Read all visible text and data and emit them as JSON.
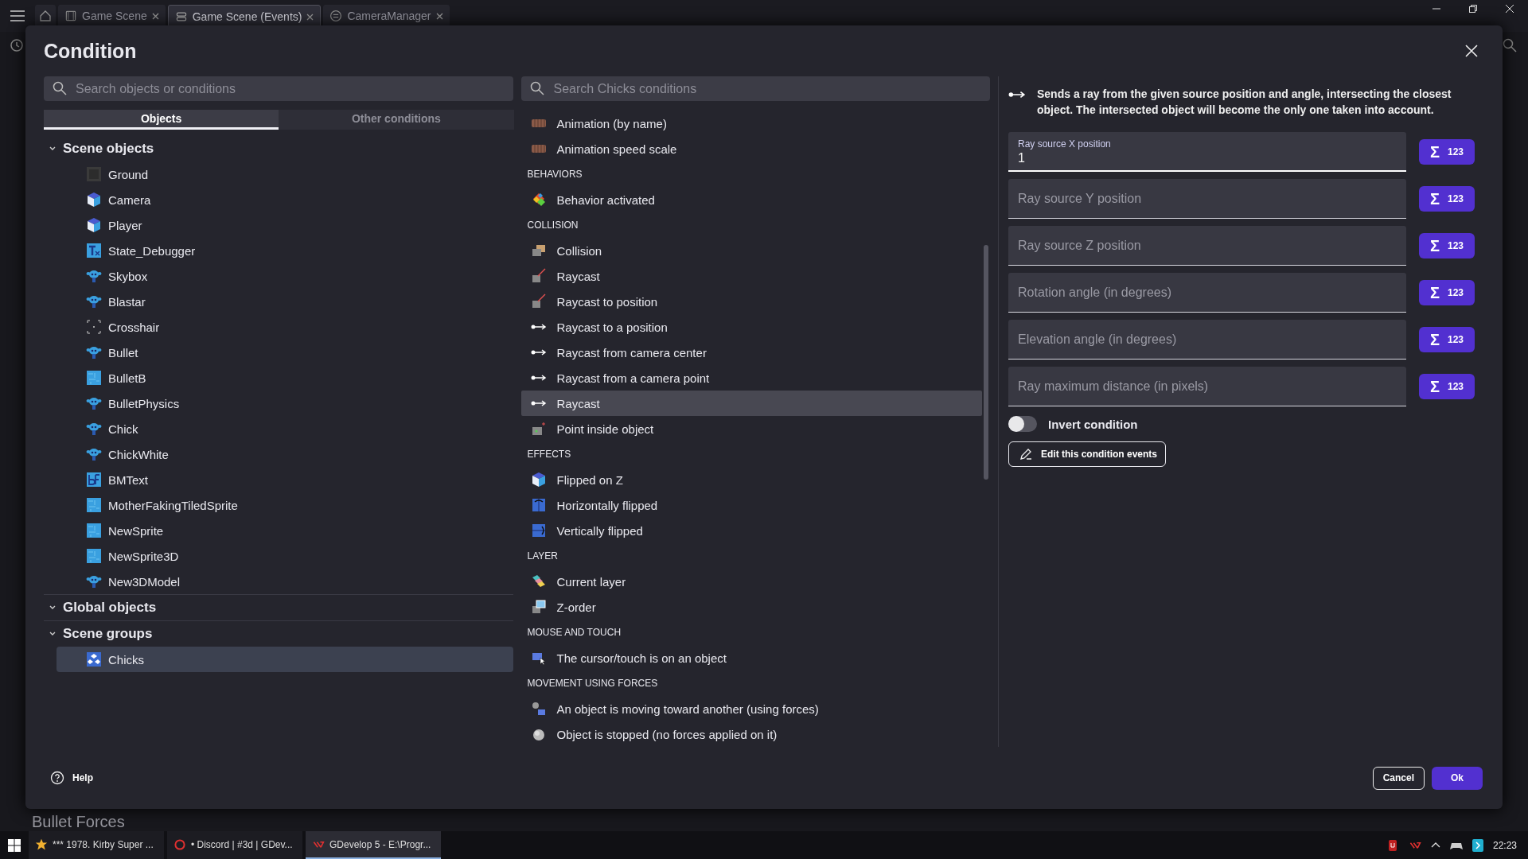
{
  "top_bar": {
    "tabs": [
      {
        "label": "Game Scene",
        "selected": false
      },
      {
        "label": "Game Scene (Events)",
        "selected": true
      },
      {
        "label": "CameraManager",
        "selected": false
      }
    ]
  },
  "background": {
    "heading": "Bullet Forces"
  },
  "dialog": {
    "title": "Condition",
    "object_search": {
      "placeholder": "Search objects or conditions"
    },
    "object_tabs": [
      {
        "label": "Objects",
        "selected": true
      },
      {
        "label": "Other conditions",
        "selected": false
      }
    ],
    "object_tree": [
      {
        "label": "Scene objects",
        "expanded": true,
        "children": [
          {
            "label": "Ground",
            "kind": "tile",
            "selected": false
          },
          {
            "label": "Camera",
            "kind": "cube",
            "selected": false
          },
          {
            "label": "Player",
            "kind": "cube",
            "selected": false
          },
          {
            "label": "State_Debugger",
            "kind": "text",
            "selected": false
          },
          {
            "label": "Skybox",
            "kind": "model",
            "selected": false
          },
          {
            "label": "Blastar",
            "kind": "model",
            "selected": false
          },
          {
            "label": "Crosshair",
            "kind": "crosshair",
            "selected": false
          },
          {
            "label": "Bullet",
            "kind": "model",
            "selected": false
          },
          {
            "label": "BulletB",
            "kind": "sprite",
            "selected": false
          },
          {
            "label": "BulletPhysics",
            "kind": "model",
            "selected": false
          },
          {
            "label": "Chick",
            "kind": "model",
            "selected": false
          },
          {
            "label": "ChickWhite",
            "kind": "model",
            "selected": false
          },
          {
            "label": "BMText",
            "kind": "bitmap",
            "selected": false
          },
          {
            "label": "MotherFakingTiledSprite",
            "kind": "sprite",
            "selected": false
          },
          {
            "label": "NewSprite",
            "kind": "sprite",
            "selected": false
          },
          {
            "label": "NewSprite3D",
            "kind": "sprite",
            "selected": false
          },
          {
            "label": "New3DModel",
            "kind": "model",
            "selected": false
          }
        ]
      },
      {
        "label": "Global objects",
        "expanded": true
      },
      {
        "label": "Scene groups",
        "expanded": true,
        "children": [
          {
            "label": "Chicks",
            "kind": "group",
            "selected": true
          }
        ]
      }
    ],
    "condition_search": {
      "placeholder": "Search Chicks conditions"
    },
    "conditions": [
      {
        "kind": "animation",
        "label": "Animation (by name)",
        "selected": false
      },
      {
        "kind": "animation",
        "label": "Animation speed scale",
        "selected": false
      },
      {
        "kind": "header",
        "label": "BEHAVIORS"
      },
      {
        "kind": "behavior",
        "label": "Behavior activated",
        "selected": false
      },
      {
        "kind": "header",
        "label": "COLLISION"
      },
      {
        "kind": "collision",
        "label": "Collision",
        "selected": false
      },
      {
        "kind": "raybox",
        "label": "Raycast",
        "selected": false
      },
      {
        "kind": "raybox",
        "label": "Raycast to position",
        "selected": false
      },
      {
        "kind": "ray",
        "label": "Raycast to a position",
        "selected": false
      },
      {
        "kind": "ray",
        "label": "Raycast from camera center",
        "selected": false
      },
      {
        "kind": "ray",
        "label": "Raycast from a camera point",
        "selected": false
      },
      {
        "kind": "ray",
        "label": "Raycast",
        "selected": true
      },
      {
        "kind": "point",
        "label": "Point inside object",
        "selected": false
      },
      {
        "kind": "header",
        "label": "EFFECTS"
      },
      {
        "kind": "cube",
        "label": "Flipped on Z",
        "selected": false
      },
      {
        "kind": "hflip",
        "label": "Horizontally flipped",
        "selected": false
      },
      {
        "kind": "vflip",
        "label": "Vertically flipped",
        "selected": false
      },
      {
        "kind": "header",
        "label": "LAYER"
      },
      {
        "kind": "layer",
        "label": "Current layer",
        "selected": false
      },
      {
        "kind": "zorder",
        "label": "Z-order",
        "selected": false
      },
      {
        "kind": "header",
        "label": "MOUSE AND TOUCH"
      },
      {
        "kind": "cursor",
        "label": "The cursor/touch is on an object",
        "selected": false
      },
      {
        "kind": "header",
        "label": "MOVEMENT USING FORCES"
      },
      {
        "kind": "forces",
        "label": "An object is moving toward another (using forces)",
        "selected": false
      },
      {
        "kind": "ball",
        "label": "Object is stopped (no forces applied on it)",
        "selected": false
      }
    ],
    "description": "Sends a ray from the given source position and angle, intersecting the closest object. The intersected object will become the only one taken into account.",
    "parameters": [
      {
        "label": "Ray source X position",
        "value": "1",
        "focused": true,
        "button_symbol": "Σ",
        "button_label": "123"
      },
      {
        "placeholder": "Ray source Y position",
        "focused": false,
        "button_symbol": "Σ",
        "button_label": "123"
      },
      {
        "placeholder": "Ray source Z position",
        "focused": false,
        "button_symbol": "Σ",
        "button_label": "123"
      },
      {
        "placeholder": "Rotation angle (in degrees)",
        "focused": false,
        "button_symbol": "Σ",
        "button_label": "123"
      },
      {
        "placeholder": "Elevation angle (in degrees)",
        "focused": false,
        "button_symbol": "Σ",
        "button_label": "123"
      },
      {
        "placeholder": "Ray maximum distance (in pixels)",
        "focused": false,
        "button_symbol": "Σ",
        "button_label": "123"
      }
    ],
    "invert": {
      "label": "Invert condition",
      "on": false
    },
    "edit_button": "Edit this condition events",
    "help": "Help",
    "cancel": "Cancel",
    "ok": "Ok"
  },
  "taskbar": {
    "apps": [
      {
        "label": "*** 1978. Kirby Super ...",
        "active": false
      },
      {
        "label": "• Discord | #3d | GDev...",
        "active": false
      },
      {
        "label": "GDevelop 5 - E:\\Progr...",
        "active": true
      }
    ],
    "time": "22:23"
  }
}
